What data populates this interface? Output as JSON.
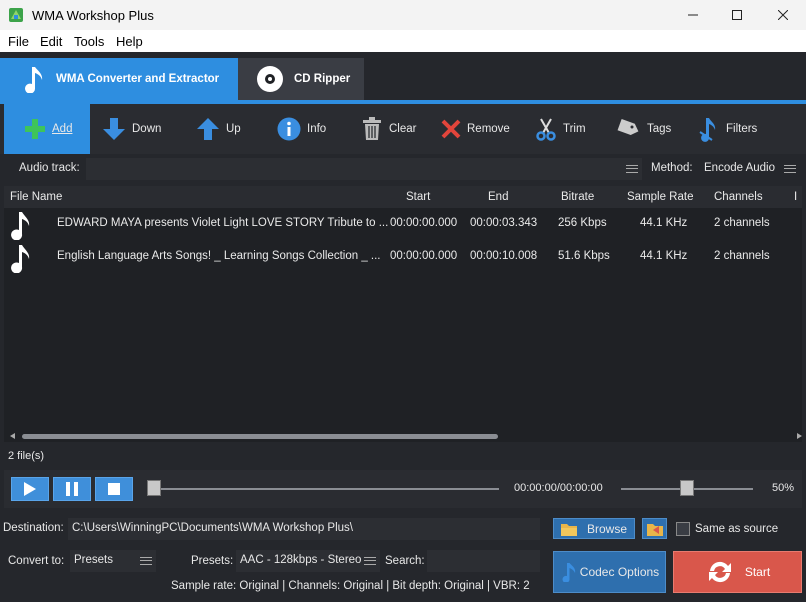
{
  "window": {
    "title": "WMA Workshop Plus"
  },
  "menu": [
    "File",
    "Edit",
    "Tools",
    "Help"
  ],
  "tabs": [
    {
      "label": "WMA Converter and Extractor",
      "icon": "music-note-icon",
      "active": true
    },
    {
      "label": "CD Ripper",
      "icon": "disc-icon",
      "active": false
    }
  ],
  "toolbar": [
    {
      "label": "Add",
      "icon": "plus-icon",
      "color": "#3ec45a"
    },
    {
      "label": "Down",
      "icon": "arrow-down-icon",
      "color": "#3a8ee0"
    },
    {
      "label": "Up",
      "icon": "arrow-up-icon",
      "color": "#3a8ee0"
    },
    {
      "label": "Info",
      "icon": "info-icon",
      "color": "#3a8ee0"
    },
    {
      "label": "Clear",
      "icon": "trash-icon",
      "color": "#bbbbbb"
    },
    {
      "label": "Remove",
      "icon": "x-icon",
      "color": "#e2453b"
    },
    {
      "label": "Trim",
      "icon": "scissors-icon",
      "color": "#3a8ee0"
    },
    {
      "label": "Tags",
      "icon": "tag-icon",
      "color": "#bbbbbb"
    },
    {
      "label": "Filters",
      "icon": "filter-note-icon",
      "color": "#3a8ee0"
    }
  ],
  "audio_track": {
    "label": "Audio track:",
    "value": ""
  },
  "method": {
    "label": "Method:",
    "value": "Encode Audio"
  },
  "table": {
    "columns": [
      "File Name",
      "Start",
      "End",
      "Bitrate",
      "Sample Rate",
      "Channels",
      "I"
    ],
    "rows": [
      {
        "name": "EDWARD MAYA presents Violet Light LOVE STORY Tribute to ...",
        "start": "00:00:00.000",
        "end": "00:00:03.343",
        "bitrate": "256 Kbps",
        "sample_rate": "44.1 KHz",
        "channels": "2 channels"
      },
      {
        "name": "English Language Arts Songs! _ Learning Songs Collection _ ...",
        "start": "00:00:00.000",
        "end": "00:00:10.008",
        "bitrate": "51.6 Kbps",
        "sample_rate": "44.1 KHz",
        "channels": "2 channels"
      }
    ]
  },
  "file_count": "2 file(s)",
  "player": {
    "time": "00:00:00/00:00:00",
    "volume": "50%",
    "volume_level": 0.5,
    "position_level": 0.0
  },
  "destination": {
    "label": "Destination:",
    "value": "C:\\Users\\WinningPC\\Documents\\WMA Workshop Plus\\",
    "browse": "Browse",
    "same_as_source": "Same as source"
  },
  "convert": {
    "label": "Convert to:",
    "value": "Presets",
    "presets_label": "Presets:",
    "presets_value": "AAC - 128kbps - Stereo",
    "search_label": "Search:",
    "search_value": ""
  },
  "buttons": {
    "codec": "Codec Options",
    "start": "Start"
  },
  "info_line": "Sample rate: Original | Channels: Original | Bit depth: Original | VBR: 2",
  "colors": {
    "accent": "#2e8ee0",
    "start": "#d9574b",
    "background": "#25272c"
  }
}
